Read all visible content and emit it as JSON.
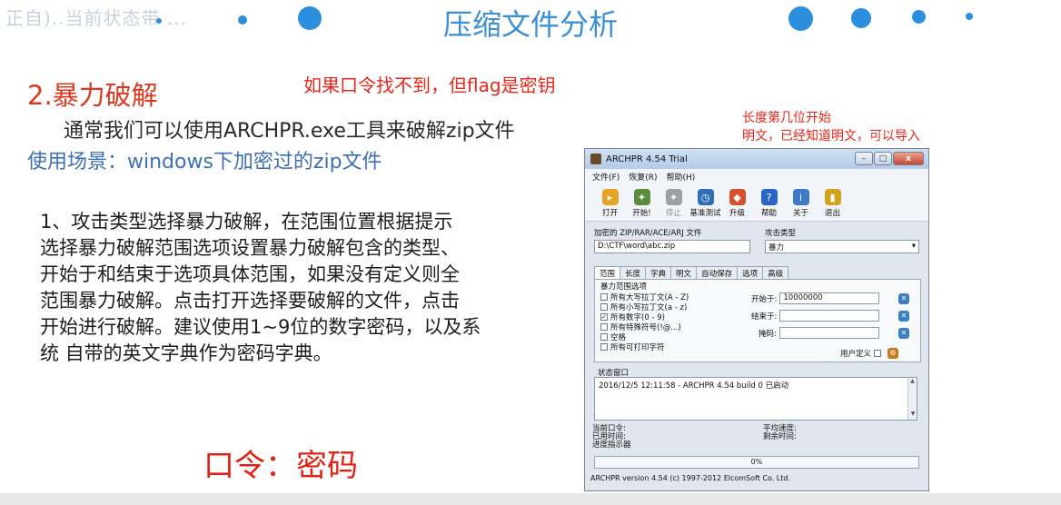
{
  "header": {
    "faded_text": "正自)..当前状态带 ...",
    "title": "压缩文件分析"
  },
  "slide": {
    "section_heading": "2.暴力破解",
    "note_top": "如果口令找不到，但flag是密钥",
    "note_right_1": "长度第几位开始",
    "note_right_2": "明文，已经知道明文，可以导入",
    "intro": "通常我们可以使用ARCHPR.exe工具来破解zip文件",
    "scene": "使用场景：windows下加密过的zip文件",
    "paragraph": "1、攻击类型选择暴力破解，在范围位置根据提示\n选择暴力破解范围选项设置暴力破解包含的类型、\n开始于和结束于选项具体范围，如果没有定义则全\n范围暴力破解。点击打开选择要破解的文件，点击\n开始进行破解。建议使用1~9位的数字密码，以及系\n统 自带的英文字典作为密码字典。",
    "bottom_note": "口令：密码"
  },
  "archpr": {
    "title": "ARCHPR 4.54 Trial",
    "window_controls": {
      "min": "–",
      "max": "□",
      "close": "x"
    },
    "menu": [
      "文件(F)",
      "恢复(R)",
      "帮助(H)"
    ],
    "toolbar": [
      {
        "label": "打开",
        "icon": "open-folder-icon",
        "color": "#e6a326",
        "glyph": "▸",
        "disabled": false
      },
      {
        "label": "开始!",
        "icon": "start-figure-icon",
        "color": "#5c8d3a",
        "glyph": "✦",
        "disabled": false
      },
      {
        "label": "停止",
        "icon": "stop-figure-icon",
        "color": "#9aa0a6",
        "glyph": "✦",
        "disabled": true
      },
      {
        "label": "基准测试",
        "icon": "benchmark-stopwatch-icon",
        "color": "#2f6fb5",
        "glyph": "◷",
        "disabled": false
      },
      {
        "label": "升级",
        "icon": "upgrade-icon",
        "color": "#d4522b",
        "glyph": "◆",
        "disabled": false
      },
      {
        "label": "帮助",
        "icon": "help-icon",
        "color": "#2a64c4",
        "glyph": "?",
        "disabled": false
      },
      {
        "label": "关于",
        "icon": "about-icon",
        "color": "#3e78c9",
        "glyph": "i",
        "disabled": false
      },
      {
        "label": "退出",
        "icon": "exit-door-icon",
        "color": "#d2a41e",
        "glyph": "▮",
        "disabled": false
      }
    ],
    "archive_label": "加密的 ZIP/RAR/ACE/ARJ 文件",
    "archive_path": "D:\\CTF\\word\\abc.zip",
    "attack_label": "攻击类型",
    "attack_value": "暴力",
    "tabs": [
      "范围",
      "长度",
      "字典",
      "明文",
      "自动保存",
      "选项",
      "高级"
    ],
    "range_group_label": "暴力范围选项",
    "charsets": [
      {
        "label": "所有大写拉丁文(A - Z)",
        "checked": false
      },
      {
        "label": "所有小写拉丁文(a - z)",
        "checked": false
      },
      {
        "label": "所有数字(0 - 9)",
        "checked": true
      },
      {
        "label": "所有特殊符号(!@...)",
        "checked": false
      },
      {
        "label": "空格",
        "checked": false
      },
      {
        "label": "所有可打印字符",
        "checked": false
      }
    ],
    "start_label": "开始于:",
    "start_value": "10000000",
    "end_label": "结束于:",
    "end_value": "",
    "mask_label": "掩码:",
    "mask_value": "",
    "user_defined_label": "用户定义",
    "status_window_label": "状态窗口",
    "status_log": "2016/12/5 12:11:58 - ARCHPR 4.54 build 0 已启动",
    "current_password_label": "当前口令:",
    "elapsed_label": "已用时间:",
    "progress_label": "进度指示器",
    "avg_speed_label": "平均速度:",
    "remaining_label": "剩余时间:",
    "progress_text": "0%",
    "footer": "ARCHPR version 4.54 (c) 1997-2012 ElcomSoft Co. Ltd."
  }
}
